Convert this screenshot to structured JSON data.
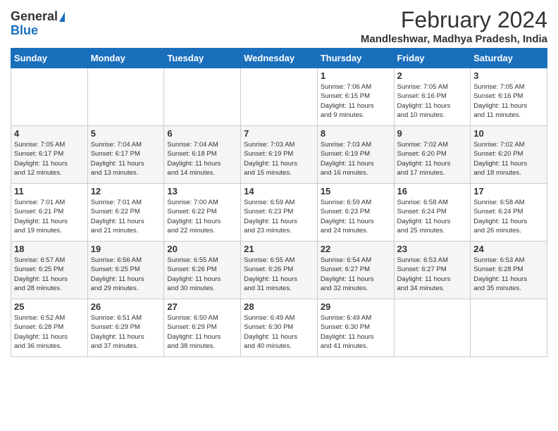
{
  "logo": {
    "general": "General",
    "blue": "Blue"
  },
  "title": {
    "month_year": "February 2024",
    "location": "Mandleshwar, Madhya Pradesh, India"
  },
  "days_of_week": [
    "Sunday",
    "Monday",
    "Tuesday",
    "Wednesday",
    "Thursday",
    "Friday",
    "Saturday"
  ],
  "weeks": [
    [
      {
        "day": "",
        "info": ""
      },
      {
        "day": "",
        "info": ""
      },
      {
        "day": "",
        "info": ""
      },
      {
        "day": "",
        "info": ""
      },
      {
        "day": "1",
        "info": "Sunrise: 7:06 AM\nSunset: 6:15 PM\nDaylight: 11 hours\nand 9 minutes."
      },
      {
        "day": "2",
        "info": "Sunrise: 7:05 AM\nSunset: 6:16 PM\nDaylight: 11 hours\nand 10 minutes."
      },
      {
        "day": "3",
        "info": "Sunrise: 7:05 AM\nSunset: 6:16 PM\nDaylight: 11 hours\nand 11 minutes."
      }
    ],
    [
      {
        "day": "4",
        "info": "Sunrise: 7:05 AM\nSunset: 6:17 PM\nDaylight: 11 hours\nand 12 minutes."
      },
      {
        "day": "5",
        "info": "Sunrise: 7:04 AM\nSunset: 6:17 PM\nDaylight: 11 hours\nand 13 minutes."
      },
      {
        "day": "6",
        "info": "Sunrise: 7:04 AM\nSunset: 6:18 PM\nDaylight: 11 hours\nand 14 minutes."
      },
      {
        "day": "7",
        "info": "Sunrise: 7:03 AM\nSunset: 6:19 PM\nDaylight: 11 hours\nand 15 minutes."
      },
      {
        "day": "8",
        "info": "Sunrise: 7:03 AM\nSunset: 6:19 PM\nDaylight: 11 hours\nand 16 minutes."
      },
      {
        "day": "9",
        "info": "Sunrise: 7:02 AM\nSunset: 6:20 PM\nDaylight: 11 hours\nand 17 minutes."
      },
      {
        "day": "10",
        "info": "Sunrise: 7:02 AM\nSunset: 6:20 PM\nDaylight: 11 hours\nand 18 minutes."
      }
    ],
    [
      {
        "day": "11",
        "info": "Sunrise: 7:01 AM\nSunset: 6:21 PM\nDaylight: 11 hours\nand 19 minutes."
      },
      {
        "day": "12",
        "info": "Sunrise: 7:01 AM\nSunset: 6:22 PM\nDaylight: 11 hours\nand 21 minutes."
      },
      {
        "day": "13",
        "info": "Sunrise: 7:00 AM\nSunset: 6:22 PM\nDaylight: 11 hours\nand 22 minutes."
      },
      {
        "day": "14",
        "info": "Sunrise: 6:59 AM\nSunset: 6:23 PM\nDaylight: 11 hours\nand 23 minutes."
      },
      {
        "day": "15",
        "info": "Sunrise: 6:59 AM\nSunset: 6:23 PM\nDaylight: 11 hours\nand 24 minutes."
      },
      {
        "day": "16",
        "info": "Sunrise: 6:58 AM\nSunset: 6:24 PM\nDaylight: 11 hours\nand 25 minutes."
      },
      {
        "day": "17",
        "info": "Sunrise: 6:58 AM\nSunset: 6:24 PM\nDaylight: 11 hours\nand 26 minutes."
      }
    ],
    [
      {
        "day": "18",
        "info": "Sunrise: 6:57 AM\nSunset: 6:25 PM\nDaylight: 11 hours\nand 28 minutes."
      },
      {
        "day": "19",
        "info": "Sunrise: 6:56 AM\nSunset: 6:25 PM\nDaylight: 11 hours\nand 29 minutes."
      },
      {
        "day": "20",
        "info": "Sunrise: 6:55 AM\nSunset: 6:26 PM\nDaylight: 11 hours\nand 30 minutes."
      },
      {
        "day": "21",
        "info": "Sunrise: 6:55 AM\nSunset: 6:26 PM\nDaylight: 11 hours\nand 31 minutes."
      },
      {
        "day": "22",
        "info": "Sunrise: 6:54 AM\nSunset: 6:27 PM\nDaylight: 11 hours\nand 32 minutes."
      },
      {
        "day": "23",
        "info": "Sunrise: 6:53 AM\nSunset: 6:27 PM\nDaylight: 11 hours\nand 34 minutes."
      },
      {
        "day": "24",
        "info": "Sunrise: 6:53 AM\nSunset: 6:28 PM\nDaylight: 11 hours\nand 35 minutes."
      }
    ],
    [
      {
        "day": "25",
        "info": "Sunrise: 6:52 AM\nSunset: 6:28 PM\nDaylight: 11 hours\nand 36 minutes."
      },
      {
        "day": "26",
        "info": "Sunrise: 6:51 AM\nSunset: 6:29 PM\nDaylight: 11 hours\nand 37 minutes."
      },
      {
        "day": "27",
        "info": "Sunrise: 6:50 AM\nSunset: 6:29 PM\nDaylight: 11 hours\nand 38 minutes."
      },
      {
        "day": "28",
        "info": "Sunrise: 6:49 AM\nSunset: 6:30 PM\nDaylight: 11 hours\nand 40 minutes."
      },
      {
        "day": "29",
        "info": "Sunrise: 6:49 AM\nSunset: 6:30 PM\nDaylight: 11 hours\nand 41 minutes."
      },
      {
        "day": "",
        "info": ""
      },
      {
        "day": "",
        "info": ""
      }
    ]
  ]
}
